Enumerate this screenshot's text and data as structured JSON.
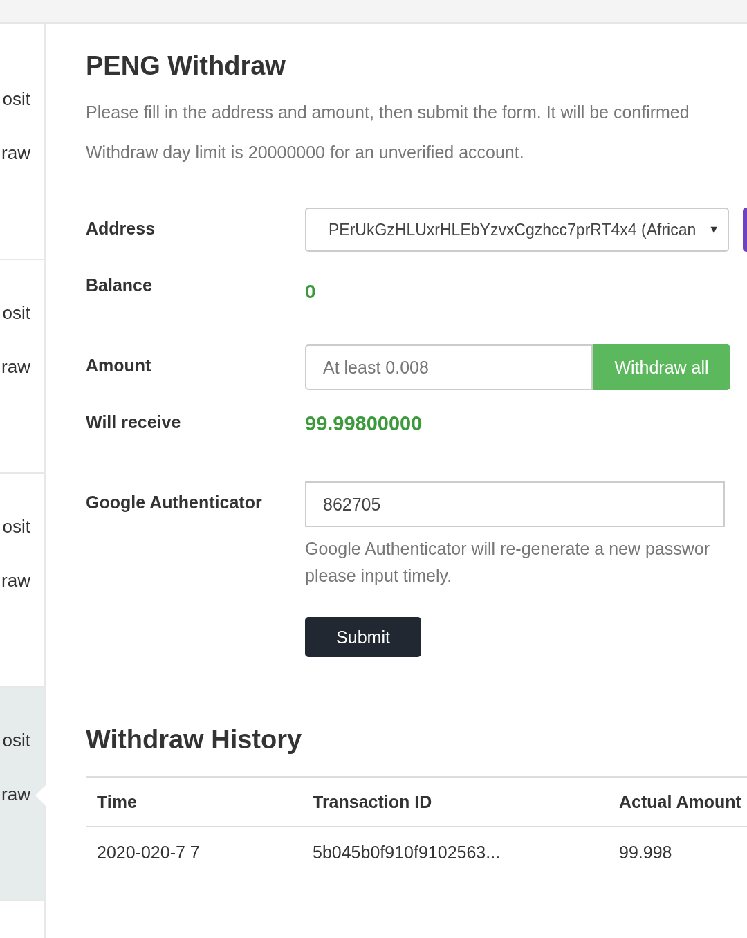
{
  "sidebar": {
    "groups": [
      {
        "active": false,
        "items": [
          {
            "label": "osit",
            "selected": false
          },
          {
            "label": "raw",
            "selected": false
          }
        ]
      },
      {
        "active": false,
        "items": [
          {
            "label": "osit",
            "selected": false
          },
          {
            "label": "raw",
            "selected": false
          }
        ]
      },
      {
        "active": false,
        "items": [
          {
            "label": "osit",
            "selected": false
          },
          {
            "label": "raw",
            "selected": false
          }
        ]
      },
      {
        "active": true,
        "items": [
          {
            "label": "osit",
            "selected": false
          },
          {
            "label": "raw",
            "selected": true
          }
        ]
      }
    ]
  },
  "title": "PENG Withdraw",
  "notes": [
    "Please fill in the address and amount, then submit the form. It will be confirmed",
    "Withdraw day limit is 20000000 for an unverified account."
  ],
  "form": {
    "address": {
      "label": "Address",
      "value": "PErUkGzHLUxrHLEbYzvxCgzhcc7prRT4x4 (African",
      "caret": "▼"
    },
    "balance": {
      "label": "Balance",
      "value": "0"
    },
    "amount": {
      "label": "Amount",
      "placeholder": "At least 0.008",
      "button": "Withdraw all"
    },
    "receive": {
      "label": "Will receive",
      "value": "99.99800000"
    },
    "authenticator": {
      "label": "Google Authenticator",
      "value": "862705",
      "help": "Google Authenticator will re-generate a new passwor please input timely."
    },
    "submit": "Submit"
  },
  "history": {
    "title": "Withdraw History",
    "columns": [
      "Time",
      "Transaction ID",
      "Actual Amount"
    ],
    "rows": [
      [
        "2020-020-7 7",
        "5b045b0f910f9102563...",
        "99.998"
      ]
    ]
  }
}
